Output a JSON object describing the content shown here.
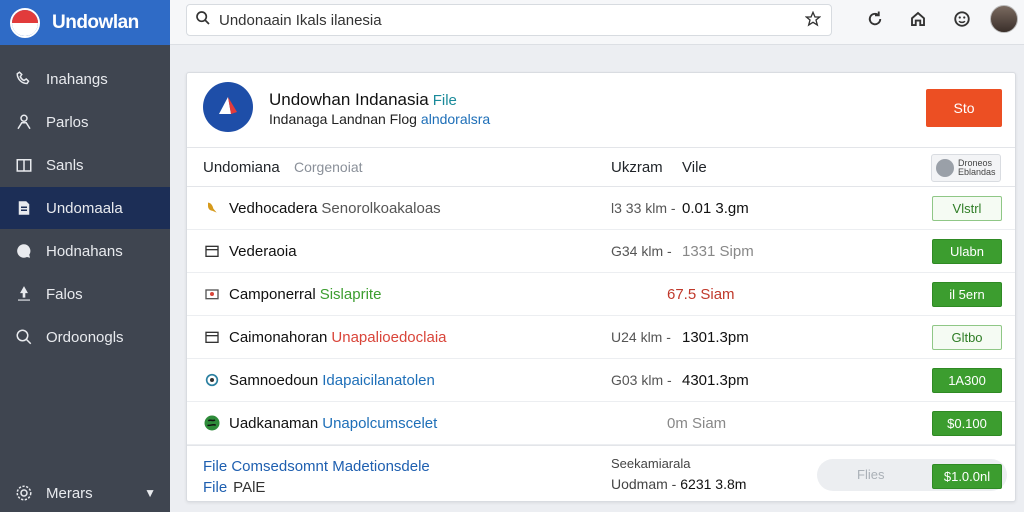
{
  "brand": {
    "name": "Undowlan"
  },
  "sidebar": {
    "items": [
      {
        "label": "Inahangs",
        "icon": "phone-icon"
      },
      {
        "label": "Parlos",
        "icon": "person-icon"
      },
      {
        "label": "Sanls",
        "icon": "dashboard-icon"
      },
      {
        "label": "Undomaala",
        "icon": "document-icon",
        "active": true
      },
      {
        "label": "Hodnahans",
        "icon": "chat-icon"
      },
      {
        "label": "Falos",
        "icon": "share-icon"
      },
      {
        "label": "Ordoonogls",
        "icon": "search-icon"
      }
    ],
    "bottom": {
      "label": "Merars",
      "icon": "settings-icon"
    }
  },
  "search": {
    "value": "Undonaain Ikals ilanesia"
  },
  "card": {
    "title": "Undowhan Indanasia",
    "title_accent": "File",
    "subtitle": "Indanaga Landnan Flog",
    "subtitle_link": "alndoralsra",
    "primary_button": "Sto",
    "headers": {
      "name": "Undomiana",
      "name_secondary": "Corgenoiat",
      "size": "Ukzram",
      "time": "Vile",
      "action": "Droneos Eblandas"
    },
    "rows": [
      {
        "icon": "bird-icon",
        "name": "Vedhocadera",
        "tag": "Senorolkoakaloas",
        "tag_color": "#555555",
        "size": "l3 33 klm -",
        "time": "0.01 3.gm",
        "button": "Vlstrl",
        "button_style": "outline"
      },
      {
        "icon": "calendar-icon",
        "name": "Vederaoia",
        "tag": "",
        "tag_color": "#555555",
        "size": "G34 klm -",
        "time": "1331 Sipm",
        "time_color": "#888888",
        "button": "Ulabn",
        "button_style": "filled"
      },
      {
        "icon": "folder-icon",
        "name": "Camponerral",
        "tag": "Sislaprite",
        "tag_color": "#3c9d2f",
        "size": "",
        "time": "67.5 Siam",
        "time_color": "#c0392b",
        "button": "il 5ern",
        "button_style": "filled"
      },
      {
        "icon": "calendar-icon",
        "name": "Caimonahoran",
        "tag": "Unapalioedoclaia",
        "tag_color": "#d9453a",
        "size": "U24 klm -",
        "time": "1301.3pm",
        "button": "Gltbo",
        "button_style": "outline"
      },
      {
        "icon": "globe-icon",
        "name": "Samnoedoun",
        "tag": "Idapaicilanatolen",
        "tag_color": "#1e6fb8",
        "size": "G03 klm -",
        "time": "4301.3pm",
        "button": "1A300",
        "button_style": "filled"
      },
      {
        "icon": "earth-icon",
        "name": "Uadkanaman",
        "tag": "Unapolcumscelet",
        "tag_color": "#1e6fb8",
        "size": "",
        "time": "0m Siam",
        "time_color": "#888888",
        "button": "$0.100",
        "button_style": "filled"
      }
    ],
    "footer": {
      "link1": "File Comsedsomnt Madetionsdele",
      "link2": "File",
      "link2_plain": "PAlE",
      "meta1": "Seekamiarala",
      "meta2_label": "Uodmam -",
      "meta2_value": "6231 3.8m",
      "pill_label": "Flies",
      "button": "$1.0.0nl"
    }
  }
}
